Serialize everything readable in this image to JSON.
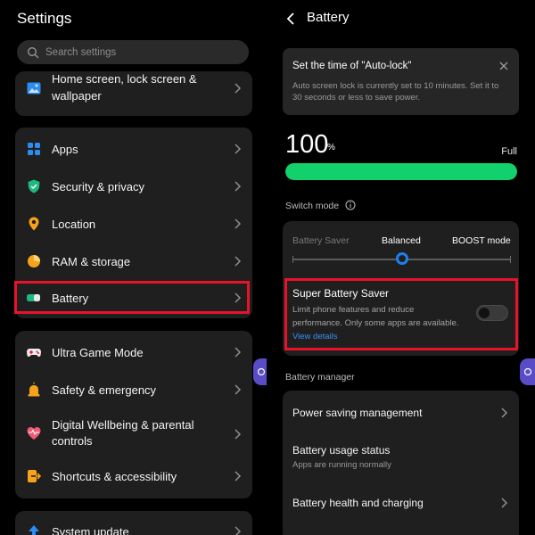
{
  "left": {
    "title": "Settings",
    "search_placeholder": "Search settings",
    "group1": [
      {
        "label_line1": "Home screen, lock screen &",
        "label_line2": "wallpaper",
        "icon": "wallpaper-icon"
      }
    ],
    "group2": [
      {
        "label": "Apps",
        "icon": "apps-icon"
      },
      {
        "label": "Security & privacy",
        "icon": "shield-icon"
      },
      {
        "label": "Location",
        "icon": "location-pin-icon"
      },
      {
        "label": "RAM & storage",
        "icon": "storage-pie-icon"
      },
      {
        "label": "Battery",
        "icon": "battery-icon"
      }
    ],
    "group3": [
      {
        "label": "Ultra Game Mode",
        "icon": "gamepad-icon"
      },
      {
        "label": "Safety & emergency",
        "icon": "alarm-light-icon"
      },
      {
        "label_line1": "Digital Wellbeing & parental",
        "label_line2": "controls",
        "icon": "heart-icon"
      },
      {
        "label": "Shortcuts & accessibility",
        "icon": "shortcut-icon"
      }
    ],
    "group4": [
      {
        "label": "System update",
        "icon": "update-arrow-icon"
      }
    ]
  },
  "right": {
    "title": "Battery",
    "notice": {
      "title": "Set the time of \"Auto-lock\"",
      "body": "Auto screen lock is currently set to 10 minutes. Set it to 30 seconds or less to save power."
    },
    "battery": {
      "level": "100",
      "percent_sign": "%",
      "status": "Full",
      "fill": 1.0
    },
    "switch_mode": {
      "heading": "Switch mode",
      "modes": [
        "Battery Saver",
        "Balanced",
        "BOOST mode"
      ],
      "selected_position": 0.5
    },
    "super_saver": {
      "title": "Super Battery Saver",
      "desc": "Limit phone features and reduce performance. Only some apps are available. ",
      "link": "View details",
      "enabled": false
    },
    "manager": {
      "heading": "Battery manager",
      "items": [
        {
          "title": "Power saving management",
          "subtitle": ""
        },
        {
          "title": "Battery usage status",
          "subtitle": "Apps are running normally"
        },
        {
          "title": "Battery health and charging",
          "subtitle": ""
        }
      ]
    }
  },
  "colors": {
    "accent_blue": "#1e7ff1",
    "battery_green": "#12d16d",
    "highlight_red": "#e8132b",
    "link_blue": "#3d8ef5"
  }
}
